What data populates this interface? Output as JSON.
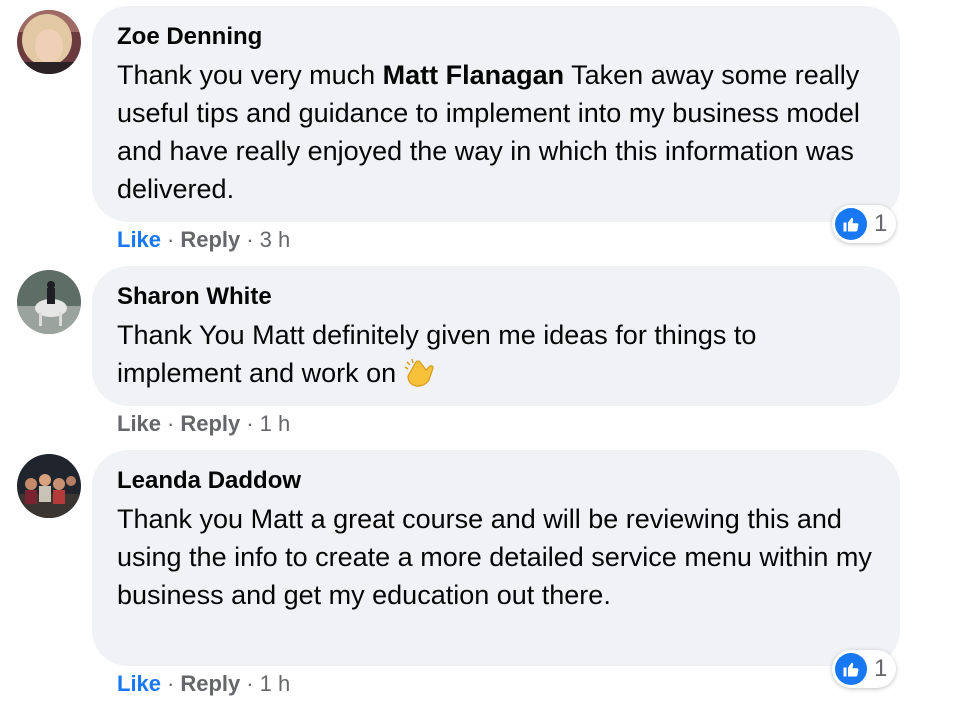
{
  "comments": [
    {
      "author": "Zoe Denning",
      "text_before": "Thank you very much ",
      "mention": "Matt Flanagan",
      "text_after": " Taken away some really useful tips and guidance to implement into my business model and have really enjoyed the way in which this information was delivered.",
      "like_label": "Like",
      "reply_label": "Reply",
      "time": "3 h",
      "reaction_count": "1",
      "reaction_icon": "thumbs-up-icon"
    },
    {
      "author": "Sharon White",
      "text": "Thank You Matt definitely given me ideas for things to implement and work on",
      "emoji": "clapping-hands-emoji",
      "like_label": "Like",
      "reply_label": "Reply",
      "time": "1 h"
    },
    {
      "author": "Leanda Daddow",
      "text": "Thank you Matt a great course and will be reviewing this and using the info to create a more detailed service menu within my business and get my education out there.",
      "like_label": "Like",
      "reply_label": "Reply",
      "time": "1 h",
      "reaction_count": "1",
      "reaction_icon": "thumbs-up-icon"
    }
  ],
  "separator": "·",
  "colors": {
    "bubble": "#f0f2f5",
    "link": "#1877f2",
    "meta": "#65676b"
  }
}
